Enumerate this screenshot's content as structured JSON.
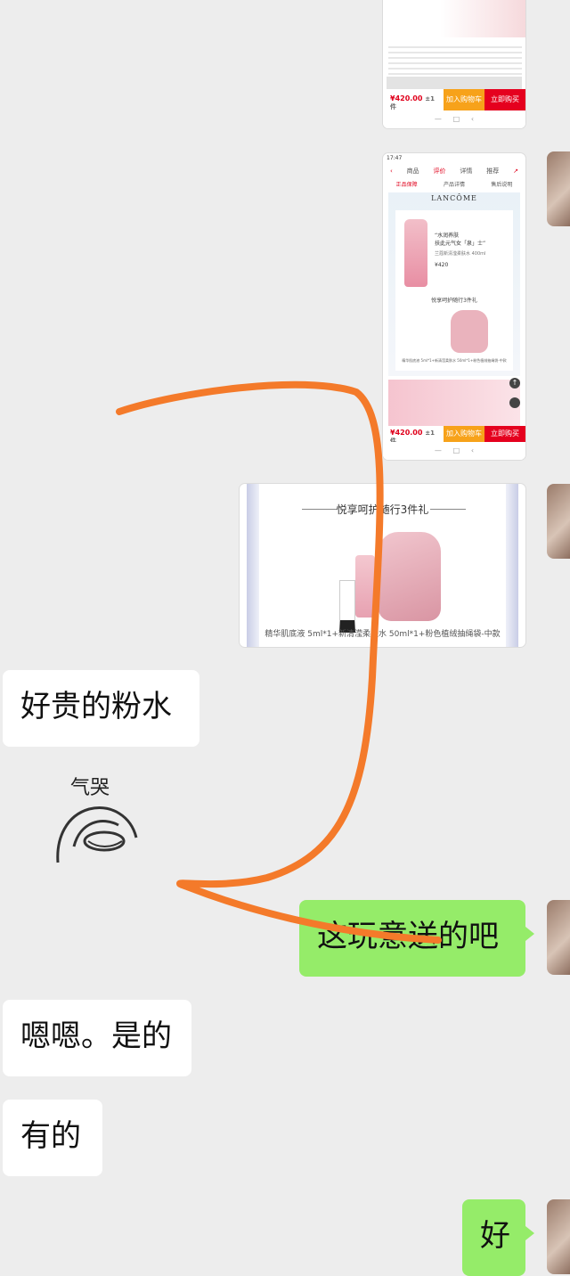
{
  "screenshot1": {
    "price": "¥420.00",
    "unit": "±1件",
    "cart_label": "加入购物车",
    "buy_label": "立即购买"
  },
  "screenshot2": {
    "status_time": "17:47",
    "tabs": [
      "商品",
      "评价",
      "详情",
      "推荐"
    ],
    "subtabs": [
      "正品保障",
      "产品详情",
      "售后说明"
    ],
    "brand": "LANCÔME",
    "tagline1": "“水润养肤",
    "tagline2": "扶此元气女「泉」士”",
    "subtitle": "兰蔻新清滢柔肤水 400ml",
    "price_small": "¥420",
    "gift_title": "悦享呵护随行3件礼",
    "gift_desc": "精华肌底液 5ml*1+新清滢柔肤水 50ml*1+粉色植绒抽绳袋-中款",
    "price": "¥420.00",
    "unit": "±1件",
    "cart_label": "加入购物车",
    "buy_label": "立即购买"
  },
  "screenshot3": {
    "gift_title": "悦享呵护随行3件礼",
    "gift_desc": "精华肌底液 5ml*1+新清滢柔肤水 50ml*1+粉色植绒抽绳袋-中款"
  },
  "messages": {
    "m1": "好贵的粉水",
    "sticker_text": "气哭",
    "m2": "这玩意送的吧",
    "m3": "嗯嗯。是的",
    "m4": "有的",
    "m5": "好"
  },
  "colors": {
    "right_bubble": "#95ec69",
    "left_bubble": "#ffffff",
    "background": "#ededed",
    "annotation": "#f47a2a"
  }
}
